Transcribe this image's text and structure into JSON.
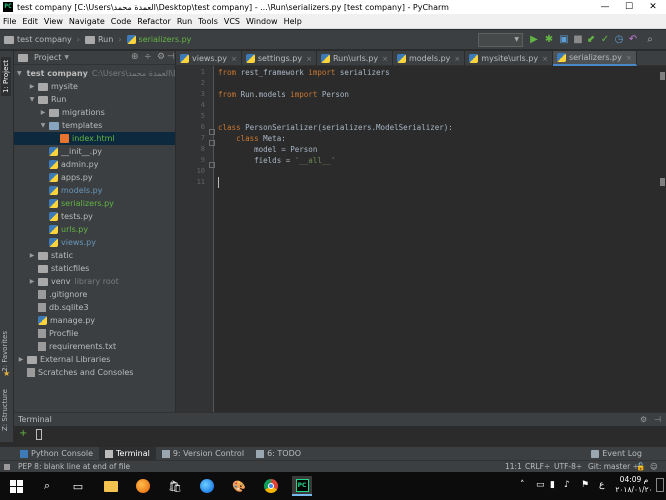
{
  "window": {
    "app_icon": "PC",
    "title": "test company [C:\\Users\\العمدة محمد\\Desktop\\test company] - ...\\Run\\serializers.py [test company] - PyCharm",
    "controls": [
      "minimize-icon",
      "maximize-icon",
      "close-icon"
    ]
  },
  "menu": [
    "File",
    "Edit",
    "View",
    "Navigate",
    "Code",
    "Refactor",
    "Run",
    "Tools",
    "VCS",
    "Window",
    "Help"
  ],
  "breadcrumb": [
    "test company",
    "Run",
    "serializers.py"
  ],
  "project_panel": {
    "title": "Project",
    "tree": [
      {
        "label": "test company",
        "sub": "C:\\Users\\العمدة محمد\\De",
        "style": "bold",
        "kind": "folder",
        "arrow": "▼"
      },
      {
        "label": "mysite",
        "kind": "folder",
        "arrow": "▶"
      },
      {
        "label": "Run",
        "kind": "folder",
        "arrow": "▼"
      },
      {
        "label": "migrations",
        "kind": "folder",
        "arrow": "▶"
      },
      {
        "label": "templates",
        "kind": "folder-blue",
        "arrow": "▼"
      },
      {
        "label": "index.html",
        "kind": "html",
        "selected": true,
        "style": "green"
      },
      {
        "label": "__init__.py",
        "kind": "py"
      },
      {
        "label": "admin.py",
        "kind": "py"
      },
      {
        "label": "apps.py",
        "kind": "py"
      },
      {
        "label": "models.py",
        "kind": "py",
        "style": "blue"
      },
      {
        "label": "serializers.py",
        "kind": "py",
        "style": "green"
      },
      {
        "label": "tests.py",
        "kind": "py"
      },
      {
        "label": "urls.py",
        "kind": "py",
        "style": "green"
      },
      {
        "label": "views.py",
        "kind": "py",
        "style": "blue"
      },
      {
        "label": "static",
        "kind": "folder",
        "arrow": "▶"
      },
      {
        "label": "staticfiles",
        "kind": "folder"
      },
      {
        "label": "venv",
        "sub": "library root",
        "kind": "folder",
        "arrow": "▶"
      },
      {
        "label": ".gitignore",
        "kind": "file"
      },
      {
        "label": "db.sqlite3",
        "kind": "file"
      },
      {
        "label": "manage.py",
        "kind": "py"
      },
      {
        "label": "Procfile",
        "kind": "file"
      },
      {
        "label": "requirements.txt",
        "kind": "file"
      },
      {
        "label": "External Libraries",
        "kind": "lib",
        "arrow": "▶"
      },
      {
        "label": "Scratches and Consoles",
        "kind": "scratch"
      }
    ]
  },
  "left_stripe": [
    "1: Project",
    "2: Favorites",
    "Z: Structure"
  ],
  "tabs": [
    {
      "label": "views.py",
      "active": false
    },
    {
      "label": "settings.py",
      "active": false
    },
    {
      "label": "Run\\urls.py",
      "active": false
    },
    {
      "label": "models.py",
      "active": false
    },
    {
      "label": "mysite\\urls.py",
      "active": false
    },
    {
      "label": "serializers.py",
      "active": true
    }
  ],
  "editor": {
    "line_numbers": [
      "1",
      "2",
      "3",
      "4",
      "5",
      "6",
      "7",
      "8",
      "9",
      "10",
      "11"
    ],
    "lines": [
      [
        {
          "t": "from",
          "c": "kw"
        },
        {
          "t": " rest_framework ",
          "c": ""
        },
        {
          "t": "import",
          "c": "kw"
        },
        {
          "t": " serializers",
          "c": ""
        }
      ],
      [],
      [
        {
          "t": "from",
          "c": "kw"
        },
        {
          "t": " Run.models ",
          "c": ""
        },
        {
          "t": "import",
          "c": "kw"
        },
        {
          "t": " Person",
          "c": ""
        }
      ],
      [],
      [],
      [
        {
          "t": "class",
          "c": "kw"
        },
        {
          "t": " PersonSerializer(serializers.ModelSerializer):",
          "c": ""
        }
      ],
      [
        {
          "t": "    ",
          "c": ""
        },
        {
          "t": "class",
          "c": "kw"
        },
        {
          "t": " Meta:",
          "c": ""
        }
      ],
      [
        {
          "t": "        model = Person",
          "c": ""
        }
      ],
      [
        {
          "t": "        fields = ",
          "c": ""
        },
        {
          "t": "'__all__'",
          "c": "str"
        }
      ],
      [],
      []
    ]
  },
  "terminal": {
    "title": "Terminal"
  },
  "bottom_tools": [
    {
      "label": "Python Console",
      "icon": "python-console-icon",
      "active": false
    },
    {
      "label": "Terminal",
      "icon": "terminal-icon",
      "active": true
    },
    {
      "label": "9: Version Control",
      "icon": "version-control-icon",
      "active": false
    },
    {
      "label": "6: TODO",
      "icon": "todo-icon",
      "active": false
    }
  ],
  "event_log": "Event Log",
  "status": {
    "message": "PEP 8: blank line at end of file",
    "position": "11:1",
    "line_sep": "CRLF÷",
    "encoding": "UTF-8÷",
    "git": "Git: master ÷"
  },
  "taskbar": {
    "lang": "ع",
    "time": "04:09 م",
    "date": "٢٠١٨/٠١/٢٠"
  }
}
